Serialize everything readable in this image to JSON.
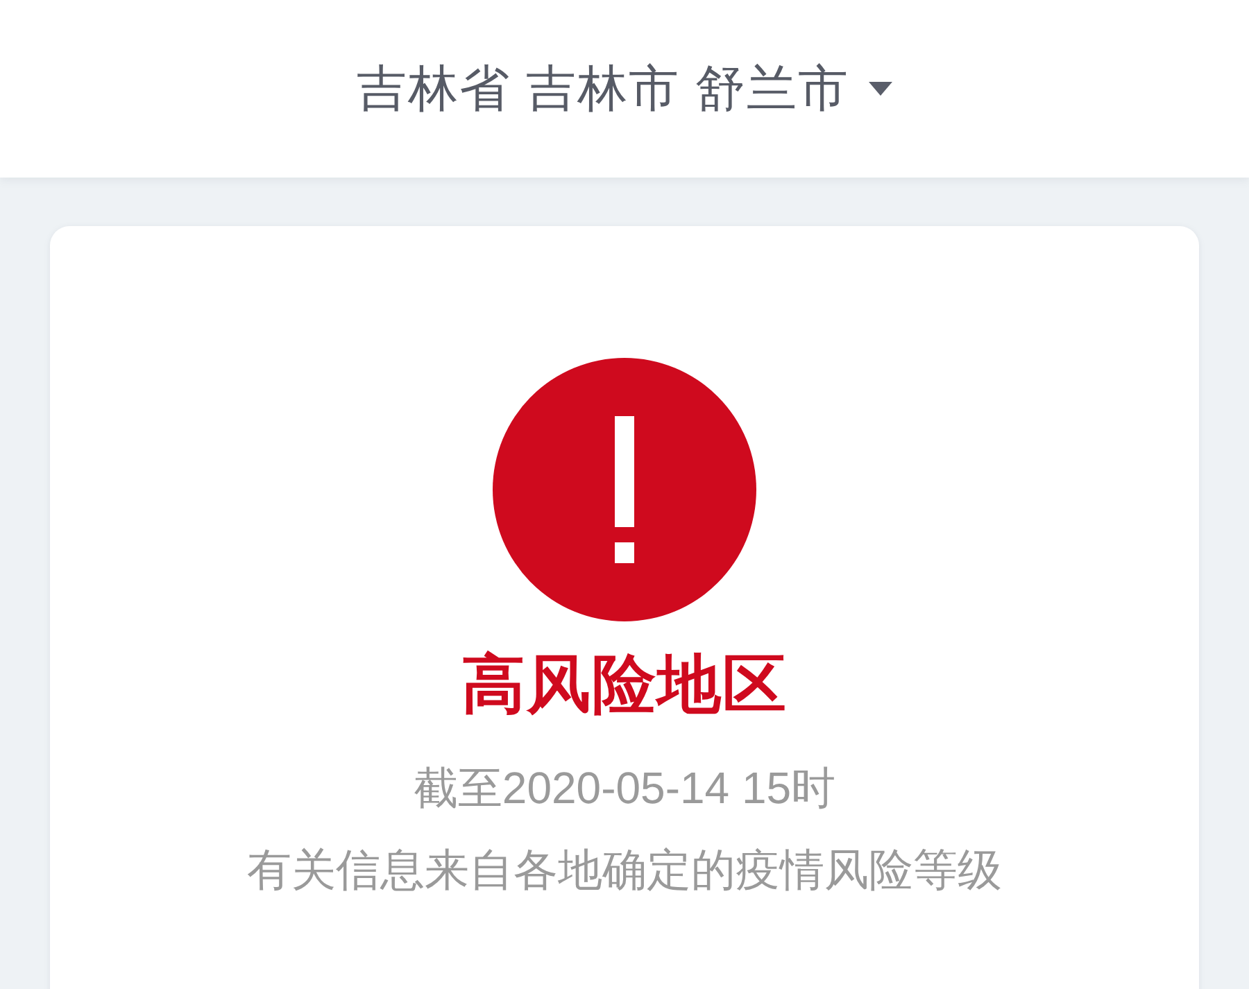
{
  "header": {
    "location": "吉林省 吉林市 舒兰市"
  },
  "risk_card": {
    "kind": "high",
    "title": "高风险地区",
    "as_of": "截至2020-05-14 15时",
    "note": "有关信息来自各地确定的疫情风险等级"
  }
}
